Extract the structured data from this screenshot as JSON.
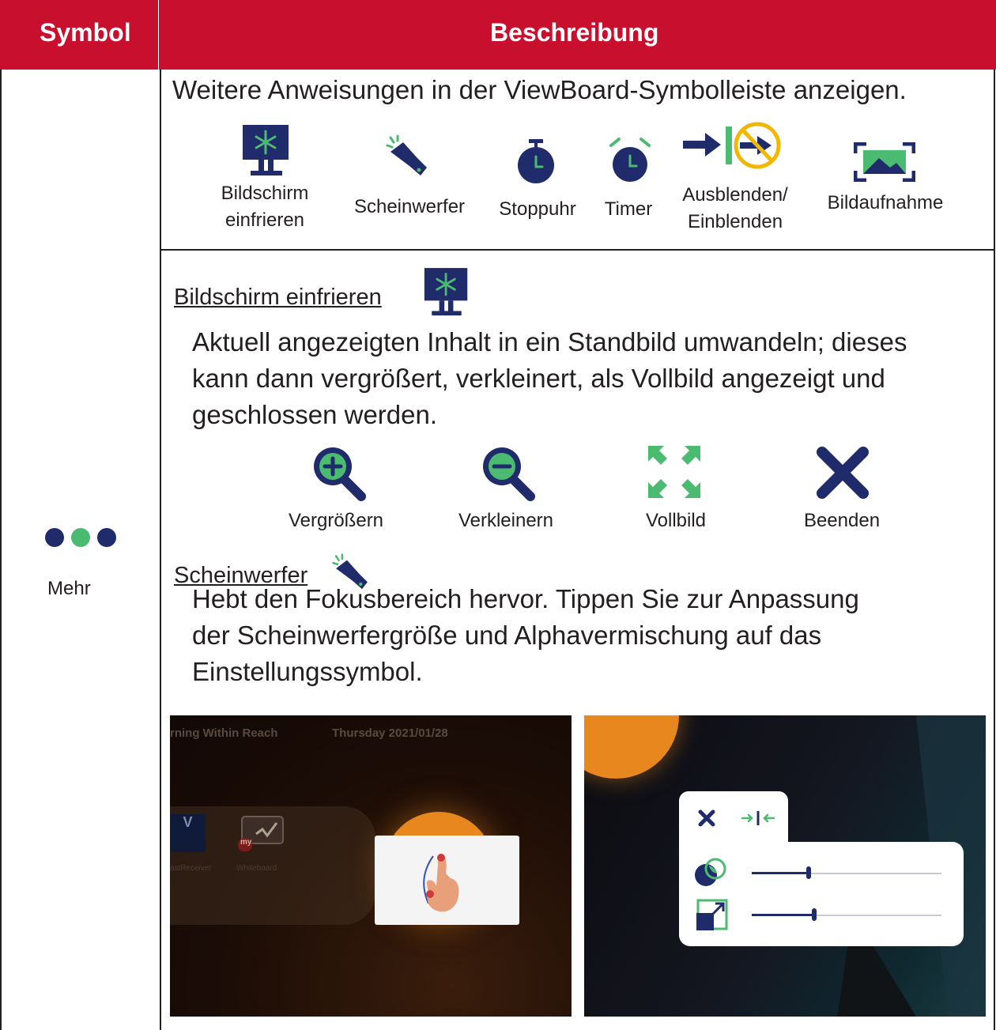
{
  "colors": {
    "header_bg": "#c8102e",
    "icon_navy": "#1f2b6b",
    "icon_green": "#4cbb72",
    "prohibit_yellow": "#f2b705"
  },
  "table": {
    "header_symbol": "Symbol",
    "header_description": "Beschreibung"
  },
  "symbol_cell": {
    "icon": "three-dots-icon",
    "label": "Mehr"
  },
  "row1": {
    "intro": "Weitere Anweisungen in der ViewBoard-Symbolleiste anzeigen.",
    "tools": [
      {
        "icon": "freeze-screen-icon",
        "line1": "Bildschirm",
        "line2": "einfrieren"
      },
      {
        "icon": "spotlight-icon",
        "line1": "Scheinwerfer",
        "line2": ""
      },
      {
        "icon": "stopwatch-icon",
        "line1": "Stoppuhr",
        "line2": ""
      },
      {
        "icon": "timer-icon",
        "line1": "Timer",
        "line2": ""
      },
      {
        "icon": "hide-show-icon",
        "line1": "Ausblenden/",
        "line2": "Einblenden"
      },
      {
        "icon": "screen-capture-icon",
        "line1": "Bildaufnahme",
        "line2": ""
      }
    ]
  },
  "freeze": {
    "heading": "Bildschirm einfrieren",
    "p1": "Aktuell angezeigten Inhalt in ein Standbild umwandeln; dieses",
    "p2": "kann dann vergrößert, verkleinert, als Vollbild angezeigt und",
    "p3": "geschlossen werden.",
    "actions": [
      {
        "icon": "zoom-in-icon",
        "label": "Vergrößern"
      },
      {
        "icon": "zoom-out-icon",
        "label": "Verkleinern"
      },
      {
        "icon": "fullscreen-icon",
        "label": "Vollbild"
      },
      {
        "icon": "close-icon",
        "label": "Beenden"
      }
    ]
  },
  "spotlight": {
    "heading": "Scheinwerfer",
    "p1": "Hebt den Fokusbereich hervor. Tippen Sie zur Anpassung",
    "p2": "der Scheinwerfergröße und Alphavermischung auf das",
    "p3": "Einstellungssymbol."
  },
  "screenshot_left": {
    "title": "rning Within Reach",
    "date": "Thursday 2021/01/28",
    "app1": "astReceiver",
    "app2": "Whiteboard",
    "app2_badge": "my",
    "app1_letter": "V"
  },
  "screenshot_right": {
    "opacity_level": 0.3,
    "size_level": 0.33
  }
}
